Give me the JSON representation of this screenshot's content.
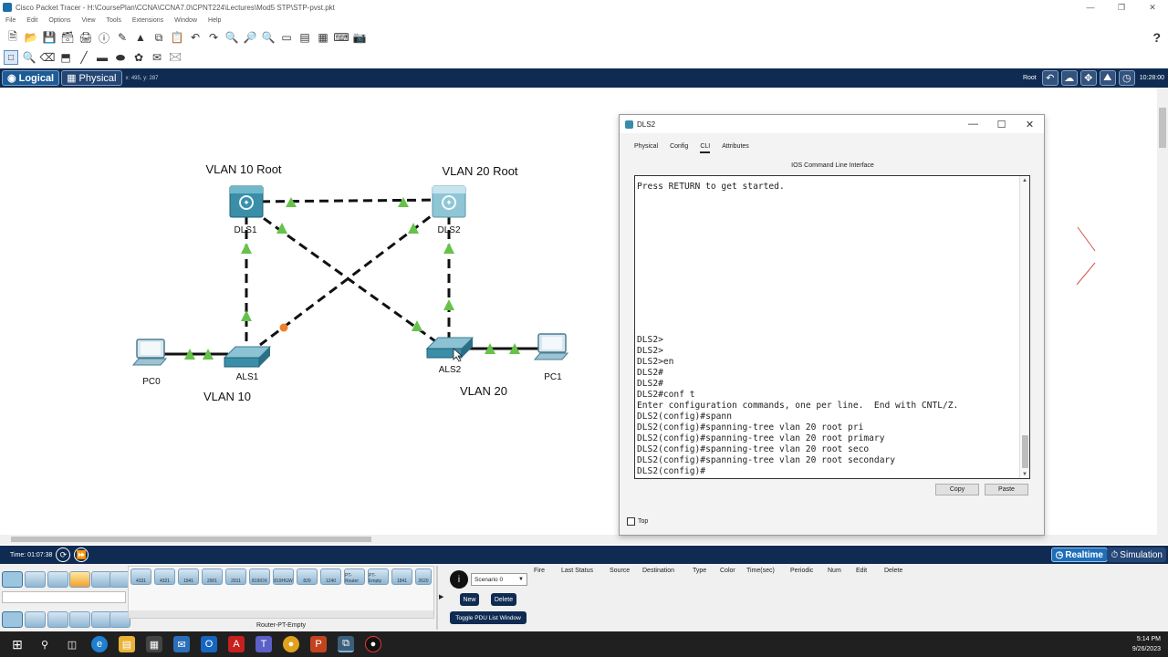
{
  "window": {
    "title": "Cisco Packet Tracer - H:\\CoursePlan\\CCNA\\CCNA7.0\\CPNT224\\Lectures\\Mod5 STP\\STP-pvst.pkt"
  },
  "menu": [
    "File",
    "Edit",
    "Options",
    "View",
    "Tools",
    "Extensions",
    "Window",
    "Help"
  ],
  "toolbar": {
    "help_label": "?"
  },
  "nav": {
    "logical_label": "Logical",
    "physical_label": "Physical",
    "coords": "x: 495, y: 287",
    "root_label": "Root",
    "clock": "10:28:00"
  },
  "topology": {
    "vlan10_root_label": "VLAN 10 Root",
    "vlan20_root_label": "VLAN 20 Root",
    "vlan10_label": "VLAN 10",
    "vlan20_label": "VLAN 20",
    "devices": {
      "dls1": "DLS1",
      "dls2": "DLS2",
      "als1": "ALS1",
      "als2": "ALS2",
      "pc0": "PC0",
      "pc1": "PC1"
    },
    "link_states": {
      "up": "#66c24a",
      "blocking": "#f07f2c"
    }
  },
  "dialog": {
    "title": "DLS2",
    "tabs": [
      "Physical",
      "Config",
      "CLI",
      "Attributes"
    ],
    "selected_tab": "CLI",
    "cli_header": "IOS Command Line Interface",
    "cli_output": "Press RETURN to get started.\n\n\n\n\n\n\n\n\n\n\n\n\n\nDLS2>\nDLS2>\nDLS2>en\nDLS2#\nDLS2#\nDLS2#conf t\nEnter configuration commands, one per line.  End with CNTL/Z.\nDLS2(config)#spann\nDLS2(config)#spanning-tree vlan 20 root pri\nDLS2(config)#spanning-tree vlan 20 root primary\nDLS2(config)#spanning-tree vlan 20 root seco\nDLS2(config)#spanning-tree vlan 20 root secondary\nDLS2(config)#",
    "copy_label": "Copy",
    "paste_label": "Paste",
    "top_label": "Top"
  },
  "status": {
    "time": "Time: 01:07:38",
    "realtime_label": "Realtime",
    "simulation_label": "Simulation"
  },
  "device_list": {
    "models": [
      "4331",
      "4321",
      "1941",
      "2901",
      "2911",
      "819IOX",
      "819HGW",
      "829",
      "1240",
      "PT-Router",
      "PT-Empty",
      "1841",
      "2620"
    ],
    "selected_model": "Router-PT-Empty"
  },
  "scenario": {
    "selected": "Scenario 0",
    "new_label": "New",
    "delete_label": "Delete",
    "toggle_label": "Toggle PDU List Window"
  },
  "pdu_columns": [
    "Fire",
    "Last Status",
    "Source",
    "Destination",
    "Type",
    "Color",
    "Time(sec)",
    "Periodic",
    "Num",
    "Edit",
    "Delete"
  ],
  "taskbar": {
    "time": "5:14 PM",
    "date": "9/26/2023"
  }
}
